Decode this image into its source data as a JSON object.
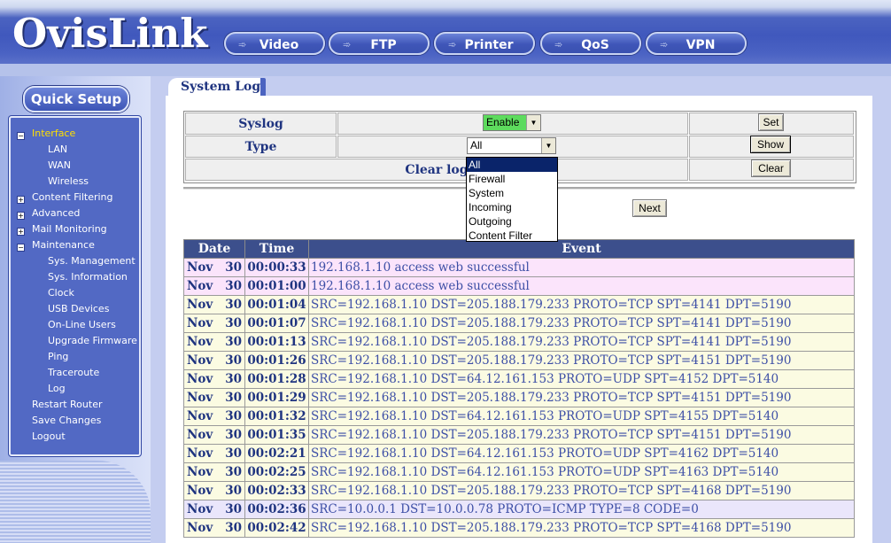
{
  "brand": {
    "logo": "OvisLink"
  },
  "topnav": [
    {
      "label": "Video"
    },
    {
      "label": "FTP"
    },
    {
      "label": "Printer"
    },
    {
      "label": "QoS"
    },
    {
      "label": "VPN"
    }
  ],
  "sidebar": {
    "quick_setup": "Quick Setup",
    "items": [
      {
        "label": "Interface",
        "active": true,
        "toggle": "-"
      },
      {
        "label": "LAN"
      },
      {
        "label": "WAN"
      },
      {
        "label": "Wireless"
      },
      {
        "label": "Content Filtering",
        "toggle": "+"
      },
      {
        "label": "Advanced",
        "toggle": "+"
      },
      {
        "label": "Mail Monitoring",
        "toggle": "+"
      },
      {
        "label": "Maintenance",
        "toggle": "-"
      },
      {
        "label": "Sys. Management"
      },
      {
        "label": "Sys. Information"
      },
      {
        "label": "Clock"
      },
      {
        "label": "USB Devices"
      },
      {
        "label": "On-Line Users"
      },
      {
        "label": "Upgrade Firmware"
      },
      {
        "label": "Ping"
      },
      {
        "label": "Traceroute"
      },
      {
        "label": "Log"
      },
      {
        "label": "Restart Router"
      },
      {
        "label": "Save Changes"
      },
      {
        "label": "Logout"
      }
    ]
  },
  "page": {
    "tab_title": "System Log",
    "syslog_label": "Syslog",
    "syslog_value": "Enable",
    "set_button": "Set",
    "type_label": "Type",
    "type_value": "All",
    "show_button": "Show",
    "clear_log_label": "Clear log",
    "clear_button": "Clear",
    "next_button": "Next",
    "type_options": [
      "All",
      "Firewall",
      "System",
      "Incoming",
      "Outgoing",
      "Content Filter"
    ]
  },
  "log": {
    "headers": [
      "Date",
      "Time",
      "Event"
    ],
    "rows": [
      {
        "month": "Nov",
        "day": "30",
        "time": "00:00:33",
        "event": "192.168.1.10 access web successful",
        "kind": "pink"
      },
      {
        "month": "Nov",
        "day": "30",
        "time": "00:01:00",
        "event": "192.168.1.10 access web successful",
        "kind": "pink"
      },
      {
        "month": "Nov",
        "day": "30",
        "time": "00:01:04",
        "event": "SRC=192.168.1.10 DST=205.188.179.233 PROTO=TCP SPT=4141 DPT=5190",
        "kind": "yel"
      },
      {
        "month": "Nov",
        "day": "30",
        "time": "00:01:07",
        "event": "SRC=192.168.1.10 DST=205.188.179.233 PROTO=TCP SPT=4141 DPT=5190",
        "kind": "yel"
      },
      {
        "month": "Nov",
        "day": "30",
        "time": "00:01:13",
        "event": "SRC=192.168.1.10 DST=205.188.179.233 PROTO=TCP SPT=4141 DPT=5190",
        "kind": "yel"
      },
      {
        "month": "Nov",
        "day": "30",
        "time": "00:01:26",
        "event": "SRC=192.168.1.10 DST=205.188.179.233 PROTO=TCP SPT=4151 DPT=5190",
        "kind": "yel"
      },
      {
        "month": "Nov",
        "day": "30",
        "time": "00:01:28",
        "event": "SRC=192.168.1.10 DST=64.12.161.153 PROTO=UDP SPT=4152 DPT=5140",
        "kind": "yel"
      },
      {
        "month": "Nov",
        "day": "30",
        "time": "00:01:29",
        "event": "SRC=192.168.1.10 DST=205.188.179.233 PROTO=TCP SPT=4151 DPT=5190",
        "kind": "yel"
      },
      {
        "month": "Nov",
        "day": "30",
        "time": "00:01:32",
        "event": "SRC=192.168.1.10 DST=64.12.161.153 PROTO=UDP SPT=4155 DPT=5140",
        "kind": "yel"
      },
      {
        "month": "Nov",
        "day": "30",
        "time": "00:01:35",
        "event": "SRC=192.168.1.10 DST=205.188.179.233 PROTO=TCP SPT=4151 DPT=5190",
        "kind": "yel"
      },
      {
        "month": "Nov",
        "day": "30",
        "time": "00:02:21",
        "event": "SRC=192.168.1.10 DST=64.12.161.153 PROTO=UDP SPT=4162 DPT=5140",
        "kind": "yel"
      },
      {
        "month": "Nov",
        "day": "30",
        "time": "00:02:25",
        "event": "SRC=192.168.1.10 DST=64.12.161.153 PROTO=UDP SPT=4163 DPT=5140",
        "kind": "yel"
      },
      {
        "month": "Nov",
        "day": "30",
        "time": "00:02:33",
        "event": "SRC=192.168.1.10 DST=205.188.179.233 PROTO=TCP SPT=4168 DPT=5190",
        "kind": "yel"
      },
      {
        "month": "Nov",
        "day": "30",
        "time": "00:02:36",
        "event": "SRC=10.0.0.1 DST=10.0.0.78 PROTO=ICMP TYPE=8 CODE=0",
        "kind": "lav"
      },
      {
        "month": "Nov",
        "day": "30",
        "time": "00:02:42",
        "event": "SRC=192.168.1.10 DST=205.188.179.233 PROTO=TCP SPT=4168 DPT=5190",
        "kind": "yel"
      }
    ]
  },
  "colors": {
    "header": "#4058bd",
    "menu": "#5269c4",
    "active_menu": "#ffe000",
    "table_header": "#3c4f8c",
    "enable_select": "#5ddb5d"
  }
}
